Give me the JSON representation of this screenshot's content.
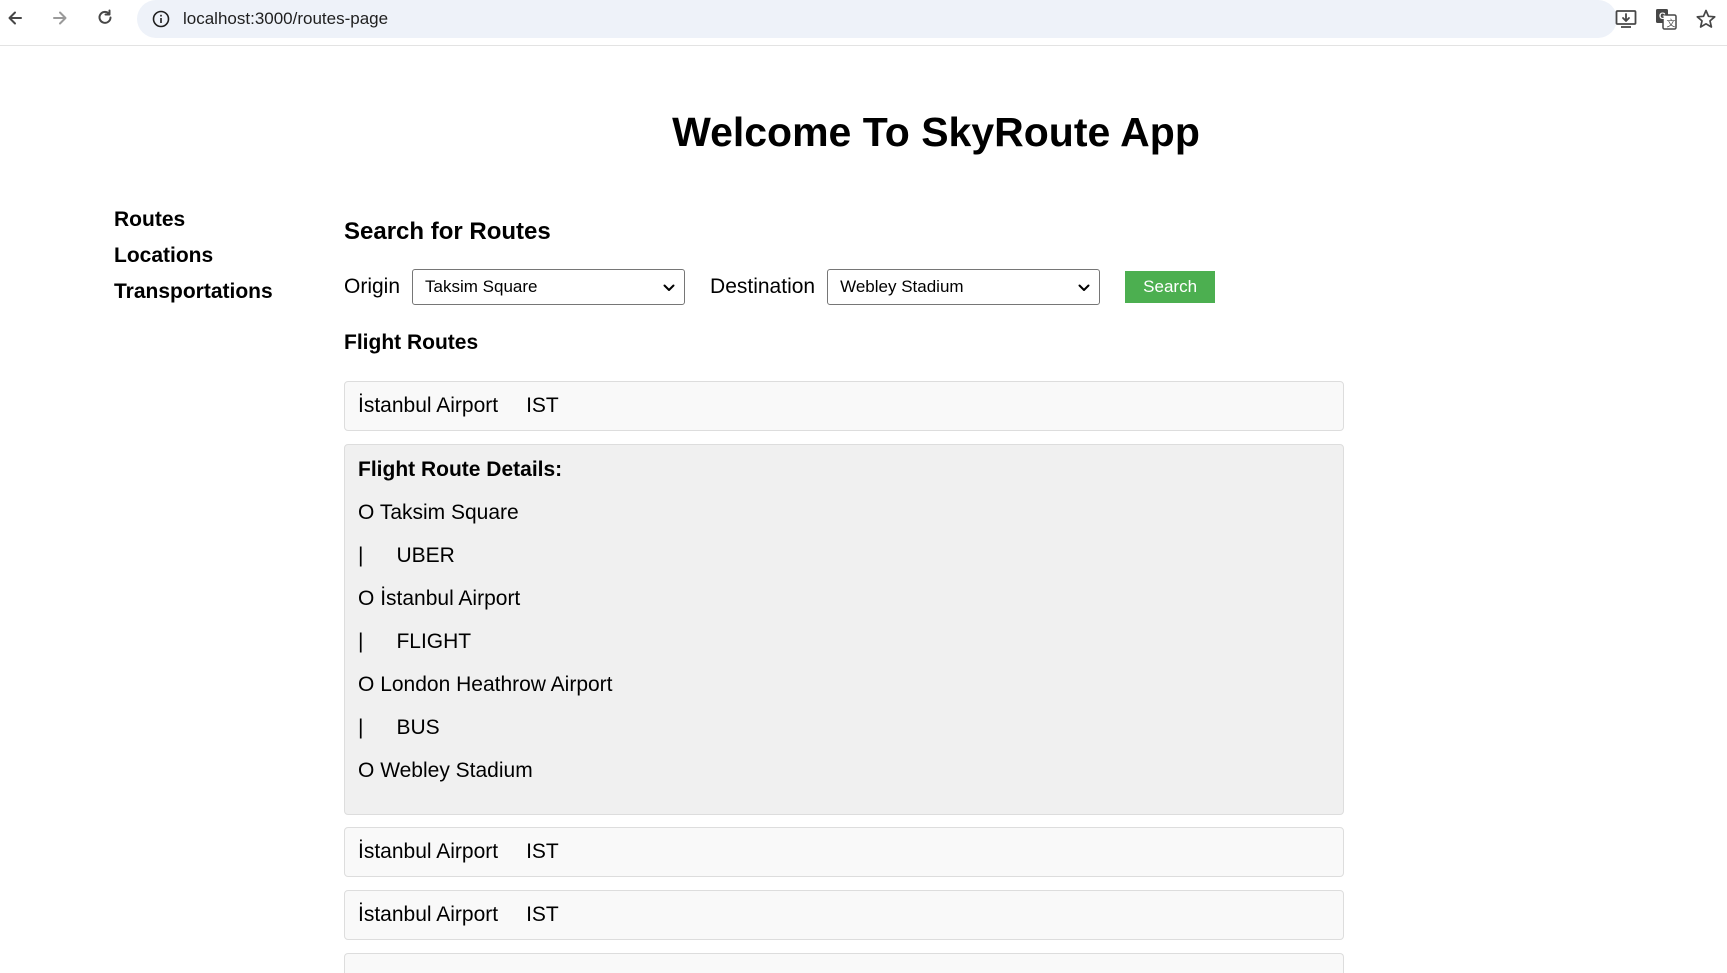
{
  "browser": {
    "url": "localhost:3000/routes-page",
    "icons": [
      "back-icon",
      "forward-icon",
      "reload-icon",
      "site-info-icon",
      "install-icon",
      "translate-icon",
      "bookmark-star-icon"
    ]
  },
  "page": {
    "title": "Welcome To SkyRoute App"
  },
  "sidebar": {
    "items": [
      {
        "label": "Routes"
      },
      {
        "label": "Locations"
      },
      {
        "label": "Transportations"
      }
    ]
  },
  "search": {
    "heading": "Search for Routes",
    "origin_label": "Origin",
    "origin_value": "Taksim Square",
    "destination_label": "Destination",
    "destination_value": "Webley Stadium",
    "button_label": "Search",
    "button_color": "#4caf50"
  },
  "flight_routes": {
    "heading": "Flight Routes",
    "routes": [
      {
        "airport": "İstanbul Airport",
        "code": "IST"
      },
      {
        "airport": "İstanbul Airport",
        "code": "IST"
      },
      {
        "airport": "İstanbul Airport",
        "code": "IST"
      }
    ],
    "details": {
      "title": "Flight Route Details:",
      "steps": [
        {
          "marker": "O",
          "text": "Taksim Square"
        },
        {
          "marker": "|",
          "text": "UBER"
        },
        {
          "marker": "O",
          "text": "İstanbul Airport"
        },
        {
          "marker": "|",
          "text": "FLIGHT"
        },
        {
          "marker": "O",
          "text": "London Heathrow Airport"
        },
        {
          "marker": "|",
          "text": "BUS"
        },
        {
          "marker": "O",
          "text": "Webley Stadium"
        }
      ]
    }
  }
}
